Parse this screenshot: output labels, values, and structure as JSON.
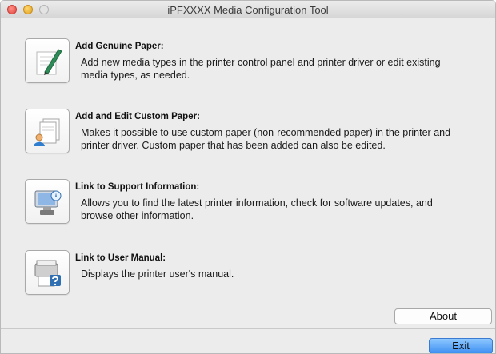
{
  "window": {
    "title": "iPFXXXX Media Configuration Tool"
  },
  "options": [
    {
      "title": "Add Genuine Paper:",
      "description": "Add new media types in the printer control panel and printer driver or edit existing media types, as needed.",
      "icon": "paper-edit-icon"
    },
    {
      "title": "Add and Edit Custom Paper:",
      "description": "Makes it possible to use custom paper (non-recommended paper) in the printer and printer driver. Custom paper that has been added can also be edited.",
      "icon": "custom-paper-user-icon"
    },
    {
      "title": "Link to Support Information:",
      "description": "Allows you to find the latest printer information, check for software updates, and browse other information.",
      "icon": "support-computer-icon"
    },
    {
      "title": "Link to User Manual:",
      "description": "Displays the printer user's manual.",
      "icon": "user-manual-help-icon"
    }
  ],
  "buttons": {
    "about": "About",
    "exit": "Exit"
  }
}
